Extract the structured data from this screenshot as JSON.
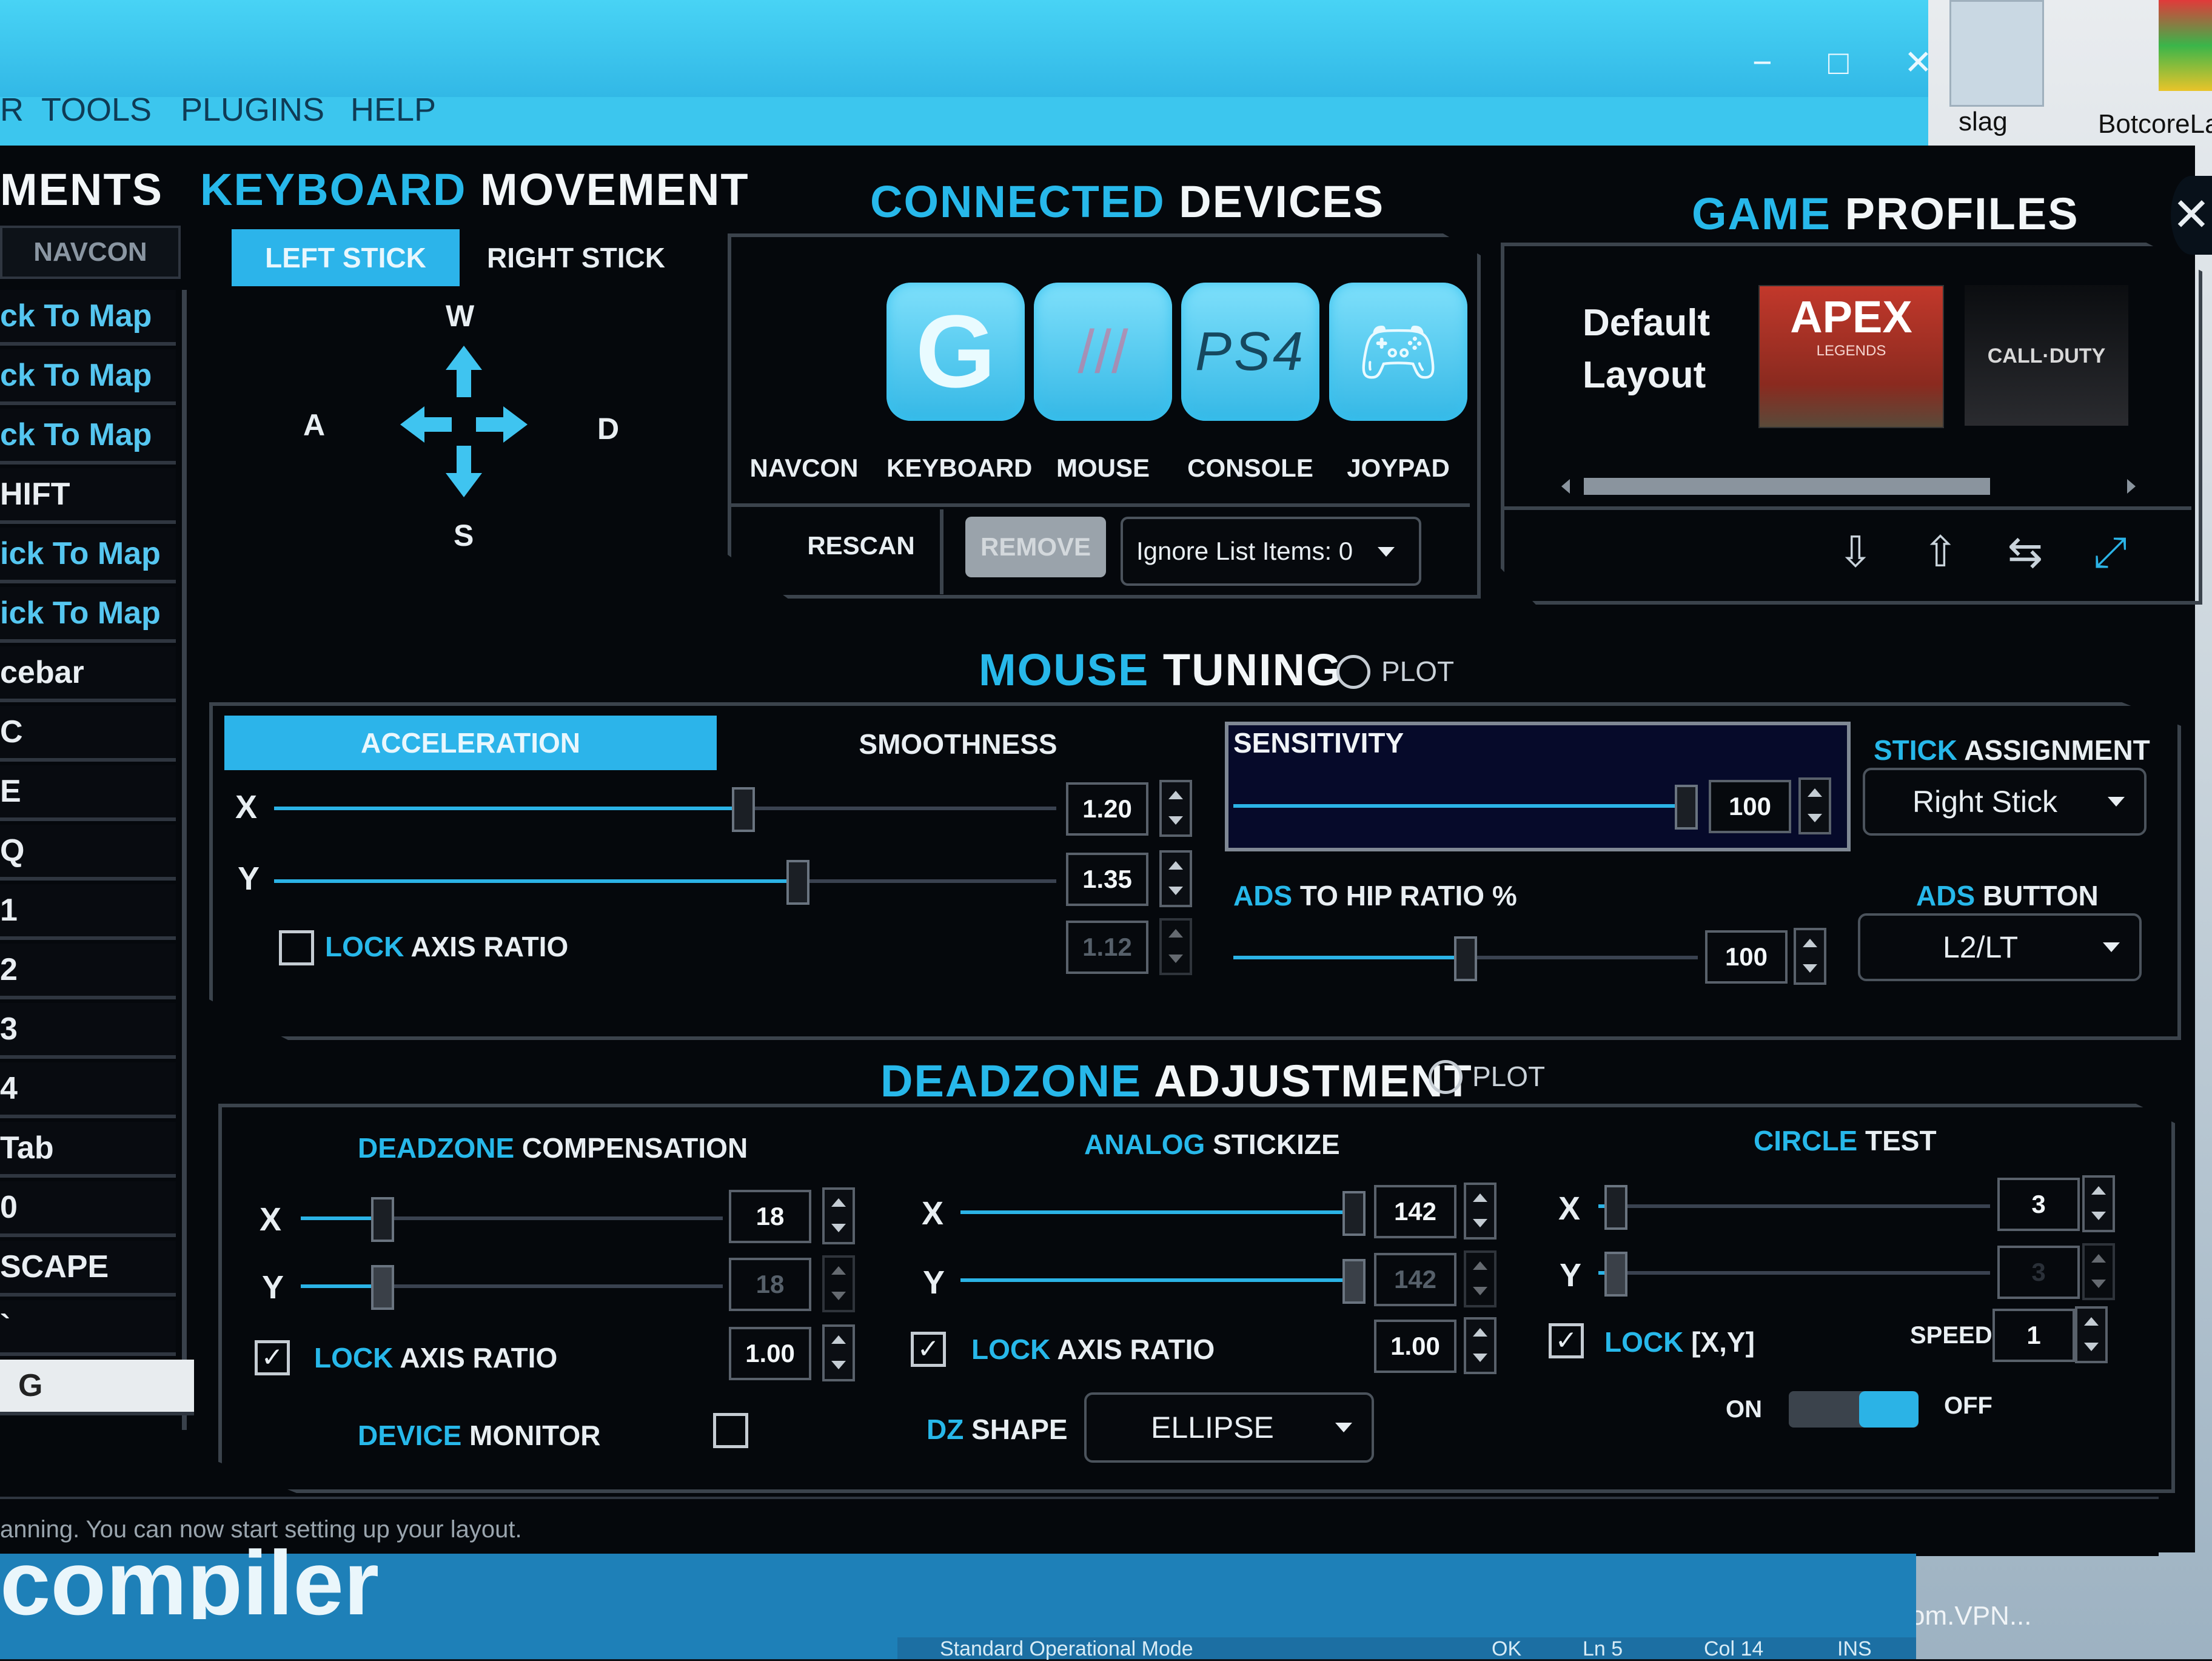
{
  "desktop": {
    "icon_label_1": "slag",
    "icon_label_2": "BotcoreLa",
    "taskbar_label": "om.VPN..."
  },
  "window": {
    "controls": {
      "minimize": "−",
      "maximize": "□",
      "close": "✕"
    }
  },
  "menu": {
    "items": [
      "TOOLS",
      "PLUGINS",
      "HELP"
    ],
    "cut_item": "R"
  },
  "left_panel": {
    "title": "MENTS",
    "tab": "NAVCON",
    "items": [
      "ck To Map",
      "ck To Map",
      "ck To Map",
      "HIFT",
      "ick To Map",
      "ick To Map",
      "cebar",
      "C",
      "E",
      "Q",
      "1",
      "2",
      "3",
      "4",
      "Tab",
      "0",
      "SCAPE",
      "`",
      "G"
    ]
  },
  "keyboard_movement": {
    "title_c": "KEYBOARD",
    "title_w": "MOVEMENT",
    "tabs": [
      "LEFT STICK",
      "RIGHT STICK"
    ],
    "keys": {
      "up": "W",
      "left": "A",
      "right": "D",
      "down": "S"
    }
  },
  "connected_devices": {
    "title_c": "CONNECTED",
    "title_w": "DEVICES",
    "devices": [
      {
        "label": "NAVCON",
        "icon": "blank"
      },
      {
        "label": "KEYBOARD",
        "icon": "logitech-g-icon"
      },
      {
        "label": "MOUSE",
        "icon": "corsair-icon"
      },
      {
        "label": "CONSOLE",
        "icon": "ps4-icon",
        "text": "PS4"
      },
      {
        "label": "JOYPAD",
        "icon": "gamepad-icon"
      }
    ],
    "rescan": "RESCAN",
    "remove": "REMOVE",
    "ignore_list": "Ignore List Items: 0"
  },
  "game_profiles": {
    "title_c": "GAME",
    "title_w": "PROFILES",
    "default_line1": "Default",
    "default_line2": "Layout",
    "apex_title": "APEX",
    "apex_sub": "LEGENDS",
    "cod_title": "CALL·DUTY",
    "icons": [
      "import-icon",
      "export-icon",
      "copy-icon",
      "expand-icon"
    ]
  },
  "mouse_tuning": {
    "title_c": "MOUSE",
    "title_w": "TUNING",
    "plot": "PLOT",
    "tabs": [
      "ACCELERATION",
      "SMOOTHNESS"
    ],
    "x_label": "X",
    "y_label": "Y",
    "x_value": "1.20",
    "y_value": "1.35",
    "ratio_value": "1.12",
    "x_level": 0.6,
    "y_level": 0.67,
    "lock_c": "LOCK",
    "lock_w": "AXIS RATIO",
    "sensitivity_label": "SENSITIVITY",
    "sensitivity_value": "100",
    "sensitivity_level": 1.0,
    "ads_c": "ADS",
    "ads_w": "TO HIP RATIO %",
    "ads_value": "100",
    "ads_level": 0.5,
    "stick_c": "STICK",
    "stick_w": "ASSIGNMENT",
    "stick_value": "Right Stick",
    "ads_button_c": "ADS",
    "ads_button_w": "BUTTON",
    "ads_button_value": "L2/LT"
  },
  "deadzone": {
    "title_c": "DEADZONE",
    "title_w": "ADJUSTMENT",
    "plot": "PLOT",
    "comp_c": "DEADZONE",
    "comp_w": "COMPENSATION",
    "comp_x": "18",
    "comp_y": "18",
    "comp_ratio": "1.00",
    "lock_c": "LOCK",
    "lock_w": "AXIS RATIO",
    "device_c": "DEVICE",
    "device_w": "MONITOR",
    "stick_c": "ANALOG",
    "stick_w": "STICKIZE",
    "stick_x": "142",
    "stick_y": "142",
    "stick_ratio": "1.00",
    "dz_c": "DZ",
    "dz_w": "SHAPE",
    "dz_value": "ELLIPSE",
    "circle_c": "CIRCLE",
    "circle_w": "TEST",
    "circle_x": "3",
    "circle_y": "3",
    "lock_xy_c": "LOCK",
    "lock_xy_w": "[X,Y]",
    "speed_label": "SPEED",
    "speed_value": "1",
    "on": "ON",
    "off": "OFF"
  },
  "status": {
    "text": "anning. You can now start setting up your layout."
  },
  "background_text": "compiler",
  "editor_status": {
    "items": [
      "OK",
      "Ln 5",
      "Col 14",
      "INS"
    ],
    "mode": "Standard Operational Mode"
  }
}
